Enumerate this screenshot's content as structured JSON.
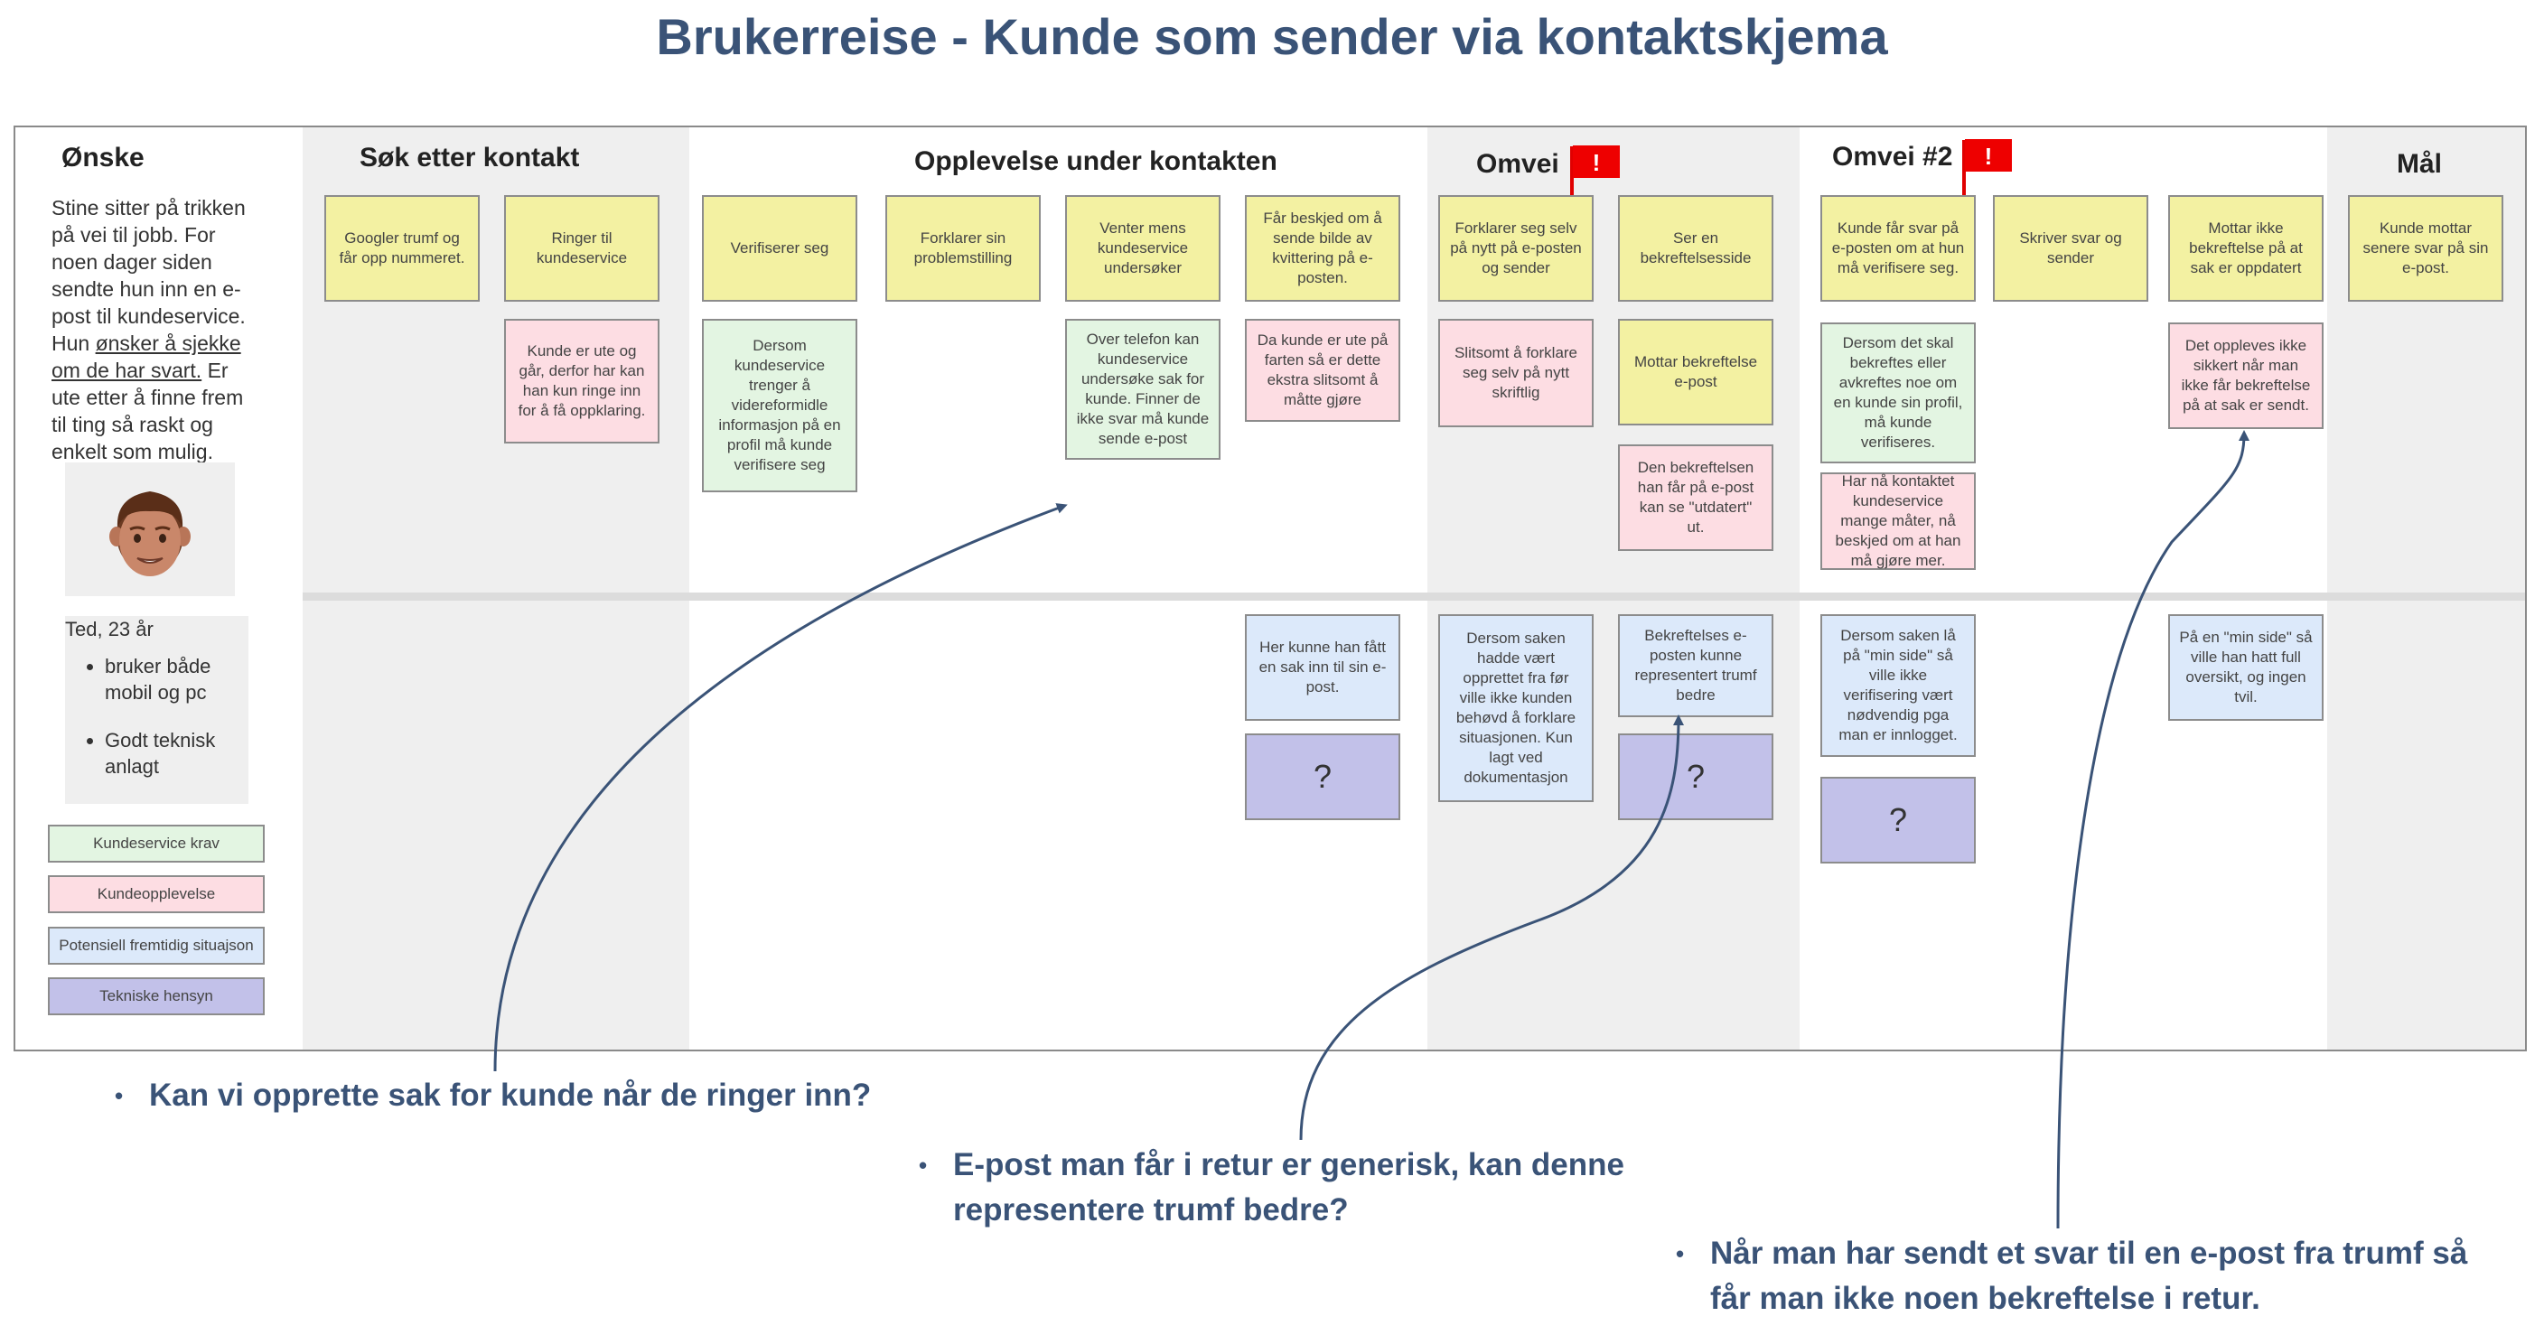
{
  "title": "Brukerreise - Kunde som sender via kontaktskjema",
  "columns": {
    "onske": "Ønske",
    "sok": "Søk etter kontakt",
    "opplevelse": "Opplevelse under kontakten",
    "omvei": "Omvei",
    "omvei2": "Omvei #2",
    "mal": "Mål"
  },
  "intro": {
    "text_before": "Stine sitter på trikken på vei til jobb. For noen dager siden sendte hun inn en e-post til kundeservice. Hun ",
    "underlined": "ønsker å sjekke om de har svart.",
    "text_after": " Er ute etter å finne frem til ting så raskt og enkelt som mulig."
  },
  "persona": {
    "name": "Ted, 23 år",
    "traits": [
      "bruker både mobil og pc",
      "Godt teknisk anlagt"
    ]
  },
  "legend": [
    "Kundeservice krav",
    "Kundeopplevelse",
    "Potensiell fremtidig situajson",
    "Tekniske hensyn"
  ],
  "flags": [
    "!",
    "!"
  ],
  "notes": {
    "s1": "Googler trumf og får opp nummeret.",
    "s2": "Ringer til kundeservice",
    "s2p": "Kunde er ute og går, derfor har kan han kun ringe inn for å få oppklaring.",
    "o1": "Verifiserer seg",
    "o1g": "Dersom kundeservice trenger å videreformidle informasjon på en profil må kunde verifisere seg",
    "o2": "Forklarer sin problemstilling",
    "o3": "Venter mens kundeservice undersøker",
    "o3g": "Over telefon kan kundeservice undersøke sak for kunde. Finner de ikke svar må kunde sende e-post",
    "o4": "Får beskjed om å sende bilde av kvittering på e-posten.",
    "o4p": "Da kunde er ute på farten så er dette ekstra slitsomt å måtte gjøre",
    "o4b": "Her kunne han fått en sak inn til sin e-post.",
    "o4q": "?",
    "v1": "Forklarer seg selv på nytt på e-posten og sender",
    "v1p": "Slitsomt å forklare seg selv på nytt skriftlig",
    "v1b": "Dersom saken hadde vært opprettet fra før ville ikke kunden behøvd å forklare situasjonen. Kun lagt ved dokumentasjon",
    "v2": "Ser en bekreftelsesside",
    "v2y": "Mottar bekreftelse e-post",
    "v2p": "Den bekreftelsen han får på e-post kan se \"utdatert\" ut.",
    "v2b": "Bekreftelses e-posten kunne representert trumf bedre",
    "v2q": "?",
    "w1": "Kunde får svar på e-posten om at hun må verifisere seg.",
    "w1g": "Dersom det skal bekreftes eller avkreftes noe om en kunde sin profil, må kunde verifiseres.",
    "w1p": "Har nå kontaktet kundeservice mange måter, nå beskjed om at han må gjøre mer.",
    "w1b": "Dersom saken lå på \"min side\" så ville ikke verifisering vært nødvendig pga man er innlogget.",
    "w1q": "?",
    "w2": "Skriver svar og sender",
    "w3": "Mottar ikke bekreftelse på at sak er oppdatert",
    "w3p": "Det oppleves ikke sikkert når man ikke får bekreftelse på at sak er sendt.",
    "w3b": "På en \"min side\" så ville han hatt full oversikt, og ingen tvil.",
    "m1": "Kunde mottar senere svar på sin e-post."
  },
  "bullets": [
    "Kan vi opprette sak for kunde når de ringer inn?",
    "E-post man får i retur er generisk, kan denne representere trumf bedre?",
    "Når man har sendt et svar til en e-post fra trumf så får man ikke noen bekreftelse i retur."
  ],
  "colors": {
    "title": "#3a5377",
    "yellow": "#f3f1a2",
    "green": "#e3f5e2",
    "pink": "#fddde3",
    "blue": "#dce9fa",
    "purple": "#c2c1e9",
    "flag": "#ee0000"
  }
}
